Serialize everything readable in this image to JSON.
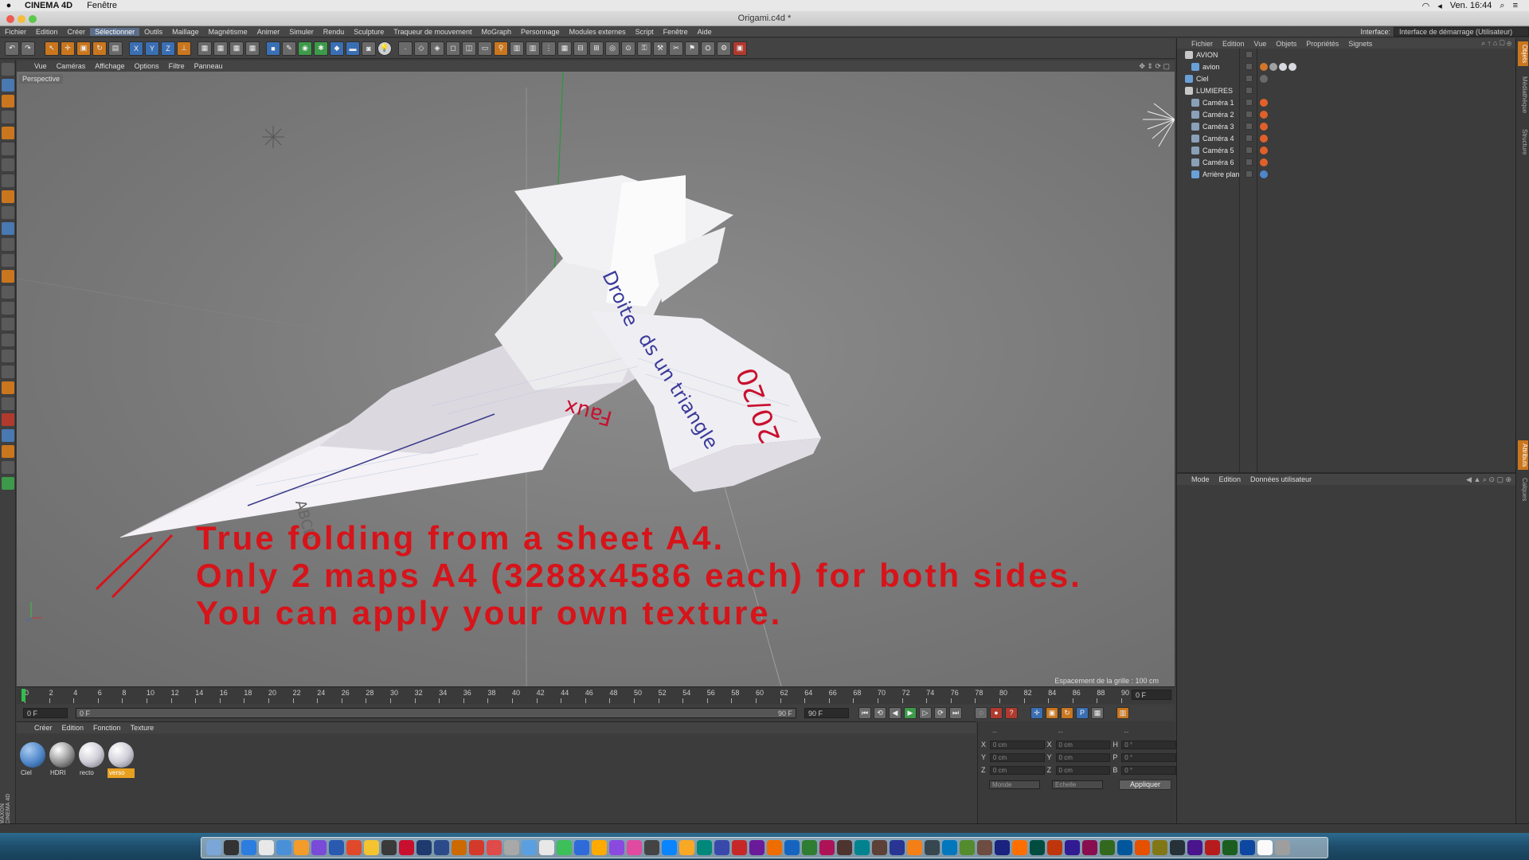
{
  "macmenu": {
    "app": "CINEMA 4D",
    "items": [
      "Fenêtre"
    ],
    "clock": "Ven. 16:44"
  },
  "window": {
    "title": "Origami.c4d *"
  },
  "menubar": {
    "items": [
      "Fichier",
      "Edition",
      "Créer",
      "Sélectionner",
      "Outils",
      "Maillage",
      "Magnétisme",
      "Animer",
      "Simuler",
      "Rendu",
      "Sculpture",
      "Traqueur de mouvement",
      "MoGraph",
      "Personnage",
      "Modules externes",
      "Script",
      "Fenêtre",
      "Aide"
    ],
    "selected": "Sélectionner",
    "interface_label": "Interface:",
    "interface_value": "Interface de démarrage (Utilisateur)"
  },
  "viewport": {
    "menu": [
      "Vue",
      "Caméras",
      "Affichage",
      "Options",
      "Filtre",
      "Panneau"
    ],
    "camera_label": "Perspective",
    "grid_note": "Espacement de la grille : 100 cm",
    "overlay_lines": [
      "True folding from a sheet A4.",
      "Only 2 maps A4 (3288x4586 each) for both sides.",
      "You can apply your own texture."
    ],
    "paper_text": {
      "a": "Droite",
      "b": "ds un triangle",
      "c": "Faux",
      "d": "20/20",
      "e": "ABCD"
    }
  },
  "timeline": {
    "ticks": [
      "0",
      "2",
      "4",
      "6",
      "8",
      "10",
      "12",
      "14",
      "16",
      "18",
      "20",
      "22",
      "24",
      "26",
      "28",
      "30",
      "32",
      "34",
      "36",
      "38",
      "40",
      "42",
      "44",
      "46",
      "48",
      "50",
      "52",
      "54",
      "56",
      "58",
      "60",
      "62",
      "64",
      "66",
      "68",
      "70",
      "72",
      "74",
      "76",
      "78",
      "80",
      "82",
      "84",
      "86",
      "88",
      "90"
    ],
    "end_field": "0 F"
  },
  "playbar": {
    "start": "0 F",
    "slider_start": "0 F",
    "slider_end": "90 F",
    "end": "90 F"
  },
  "materials": {
    "menu": [
      "Créer",
      "Edition",
      "Fonction",
      "Texture"
    ],
    "items": [
      {
        "name": "Ciel",
        "color": "#4f86c8"
      },
      {
        "name": "HDRI",
        "color": "#a8a8a8"
      },
      {
        "name": "recto",
        "color": "#d8d8e0"
      },
      {
        "name": "verso",
        "color": "#d8d8e0",
        "selected": true
      }
    ]
  },
  "coords": {
    "headers": [
      "--",
      "--",
      "--"
    ],
    "rows": [
      {
        "a": "X",
        "av": "0 cm",
        "b": "X",
        "bv": "0 cm",
        "c": "H",
        "cv": "0 °"
      },
      {
        "a": "Y",
        "av": "0 cm",
        "b": "Y",
        "bv": "0 cm",
        "c": "P",
        "cv": "0 °"
      },
      {
        "a": "Z",
        "av": "0 cm",
        "b": "Z",
        "bv": "0 cm",
        "c": "B",
        "cv": "0 °"
      }
    ],
    "mode1": "Monde",
    "mode2": "Echelle",
    "apply": "Appliquer"
  },
  "objects": {
    "menu": [
      "Fichier",
      "Edition",
      "Vue",
      "Objets",
      "Propriétés",
      "Signets"
    ],
    "items": [
      {
        "name": "AVION",
        "indent": 0,
        "type": "null",
        "tags": []
      },
      {
        "name": "avion",
        "indent": 1,
        "type": "poly",
        "tags": [
          "#d0762a",
          "#a0a0a0",
          "#d8d8e0",
          "#d8d8e0"
        ]
      },
      {
        "name": "Ciel",
        "indent": 0,
        "type": "sky",
        "tags": [
          "#6a6a6a"
        ]
      },
      {
        "name": "LUMIERES",
        "indent": 0,
        "type": "null",
        "tags": []
      },
      {
        "name": "Caméra 1",
        "indent": 1,
        "type": "cam",
        "tags": [
          "#e0602a"
        ]
      },
      {
        "name": "Caméra 2",
        "indent": 1,
        "type": "cam",
        "tags": [
          "#e0602a"
        ]
      },
      {
        "name": "Caméra 3",
        "indent": 1,
        "type": "cam",
        "tags": [
          "#e0602a"
        ]
      },
      {
        "name": "Caméra 4",
        "indent": 1,
        "type": "cam",
        "tags": [
          "#e0602a"
        ]
      },
      {
        "name": "Caméra 5",
        "indent": 1,
        "type": "cam",
        "tags": [
          "#e0602a"
        ]
      },
      {
        "name": "Caméra 6",
        "indent": 1,
        "type": "cam",
        "tags": [
          "#e0602a"
        ]
      },
      {
        "name": "Arrière plan",
        "indent": 1,
        "type": "bg",
        "tags": [
          "#4f86c8"
        ]
      }
    ]
  },
  "attributes": {
    "menu": [
      "Mode",
      "Edition",
      "Données utilisateur"
    ]
  },
  "sidetabs": [
    "Objets",
    "Médiathèque",
    "Structure",
    "Attributs",
    "Calques"
  ],
  "maxon": "MAXON CINEMA 4D",
  "colors": {
    "accent": "#5b6e8a",
    "overlay_red": "#d6141a",
    "viewport": "#7b7b7b",
    "selected_material": "#e8a020"
  }
}
